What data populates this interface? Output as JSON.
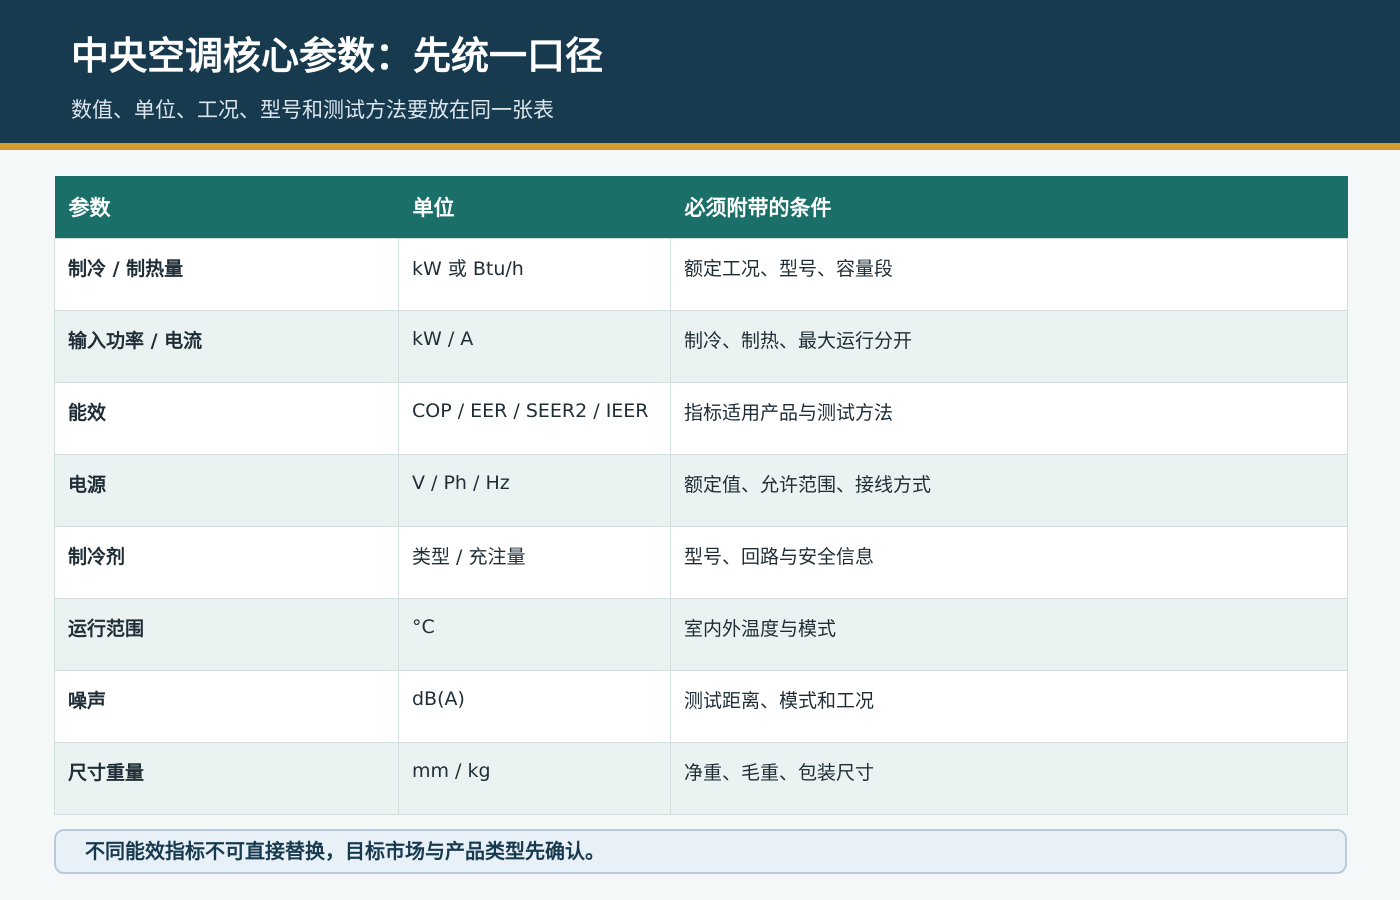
{
  "header": {
    "title": "中央空调核心参数：先统一口径",
    "subtitle": "数值、单位、工况、型号和测试方法要放在同一张表"
  },
  "table": {
    "columns": [
      "参数",
      "单位",
      "必须附带的条件"
    ],
    "rows": [
      {
        "param": "制冷 / 制热量",
        "unit": "kW 或 Btu/h",
        "condition": "额定工况、型号、容量段"
      },
      {
        "param": "输入功率 / 电流",
        "unit": "kW / A",
        "condition": "制冷、制热、最大运行分开"
      },
      {
        "param": "能效",
        "unit": "COP / EER / SEER2 / IEER",
        "condition": "指标适用产品与测试方法"
      },
      {
        "param": "电源",
        "unit": "V / Ph / Hz",
        "condition": "额定值、允许范围、接线方式"
      },
      {
        "param": "制冷剂",
        "unit": "类型 / 充注量",
        "condition": "型号、回路与安全信息"
      },
      {
        "param": "运行范围",
        "unit": "°C",
        "condition": "室内外温度与模式"
      },
      {
        "param": "噪声",
        "unit": "dB(A)",
        "condition": "测试距离、模式和工况"
      },
      {
        "param": "尺寸重量",
        "unit": "mm / kg",
        "condition": "净重、毛重、包装尺寸"
      }
    ]
  },
  "note": {
    "text": "不同能效指标不可直接替换，目标市场与产品类型先确认。"
  },
  "colors": {
    "header_bg": "#183a4f",
    "accent": "#d39a2c",
    "table_header_bg": "#1b6f69",
    "row_alt_bg": "#ebf3f2",
    "note_bg": "#e8f0f8"
  }
}
